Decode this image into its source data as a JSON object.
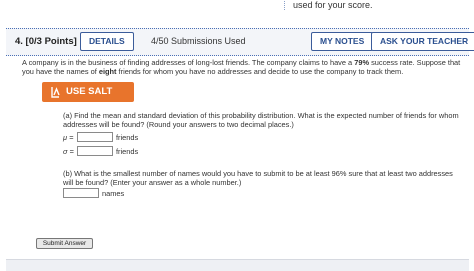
{
  "previous": {
    "text": "used for your score."
  },
  "question": {
    "number_points": "4.  [0/3 Points]",
    "details_label": "DETAILS",
    "submissions": "4/50 Submissions Used",
    "my_notes_label": "MY NOTES",
    "ask_teacher_label": "ASK YOUR TEACHER"
  },
  "problem": {
    "text_before": "A company is in the business of finding addresses of long-lost friends. The company claims to have a ",
    "rate": "79%",
    "text_middle": " success rate. Suppose that you have the names of ",
    "count": "eight",
    "text_after": " friends for whom you have no addresses and decide to use the company to track them.",
    "salt_label": "USE SALT"
  },
  "part_a": {
    "prompt": "(a) Find the mean and standard deviation of this probability distribution. What is the expected number of friends for whom addresses will be found? (Round your answers to two decimal places.)",
    "mu_symbol": "μ =",
    "mu_value": "",
    "mu_unit": "friends",
    "sigma_symbol": "σ =",
    "sigma_value": "",
    "sigma_unit": "friends"
  },
  "part_b": {
    "prompt": "(b) What is the smallest number of names would you have to submit to be at least 96% sure that at least two addresses will be found? (Enter your answer as a whole number.)",
    "names_value": "",
    "names_unit": "names"
  },
  "submit_label": "Submit Answer",
  "colors": {
    "accent_blue": "#2a4f8f",
    "salt_orange": "#e8742c",
    "header_bg": "#f3f5f9"
  },
  "icons": {
    "salt": "salt-shaker-icon"
  }
}
